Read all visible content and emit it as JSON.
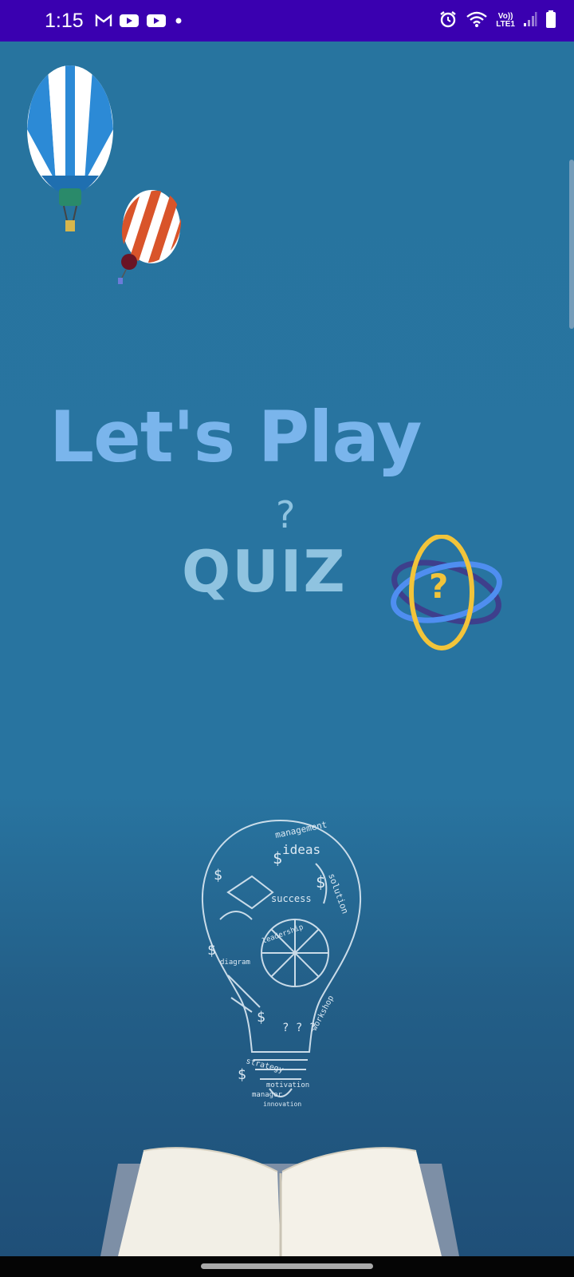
{
  "status_bar": {
    "time": "1:15",
    "left_icons": [
      "gmail-icon",
      "youtube-icon",
      "youtube-icon",
      "notification-dot-icon"
    ],
    "right_icons": [
      "alarm-icon",
      "wifi-icon",
      "volte-lte-icon",
      "signal-icon",
      "battery-icon"
    ],
    "volte_label": "Vo))",
    "lte_label": "LTE1",
    "background": "#3a00b0"
  },
  "splash": {
    "title": "Let's Play",
    "subtitle": "QUIZ",
    "subtitle_mark": "?",
    "logo_mark": "?",
    "bulb_words": [
      "management",
      "ideas",
      "success",
      "solution",
      "leadership",
      "diagram",
      "strategy",
      "motivation",
      "manager",
      "workshop",
      "innovation"
    ],
    "colors": {
      "background": "#2874a0",
      "title": "#7ab5ec",
      "quiz": "#8fc3e0",
      "logo_ring": "#f2c43a",
      "logo_orbit": "#4f8ef0"
    }
  },
  "nav": {
    "handle": "gesture-handle"
  }
}
